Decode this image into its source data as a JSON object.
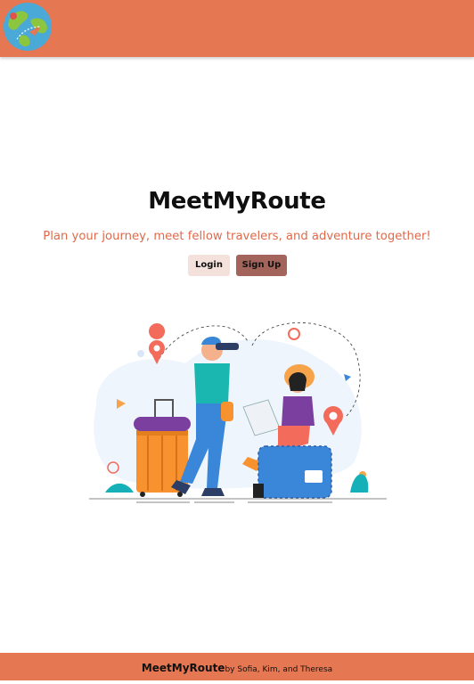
{
  "header": {
    "logo_icon": "globe-travel-icon"
  },
  "hero": {
    "title": "MeetMyRoute",
    "tagline": "Plan your journey, meet fellow travelers, and adventure together!",
    "login_label": "Login",
    "signup_label": "Sign Up",
    "illustration": "travelers-illustration"
  },
  "footer": {
    "brand": "MeetMyRoute",
    "credit": "by Sofia, Kim, and Theresa"
  },
  "colors": {
    "header_bg": "#e57752",
    "tagline": "#e0694a",
    "login_bg": "#f4e1dc",
    "signup_bg": "#a3645c"
  }
}
